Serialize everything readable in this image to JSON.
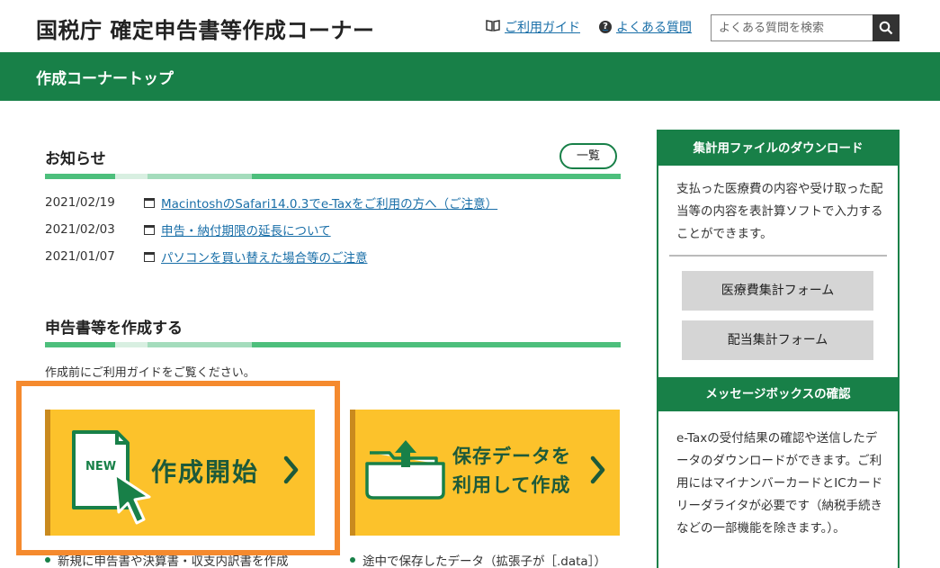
{
  "header": {
    "title": "国税庁 確定申告書等作成コーナー",
    "guide_label": "ご利用ガイド",
    "faq_label": "よくある質問",
    "search_placeholder": "よくある質問を検索"
  },
  "nav": {
    "label": "作成コーナートップ"
  },
  "news": {
    "title": "お知らせ",
    "list_button": "一覧",
    "items": [
      {
        "date": "2021/02/19",
        "text": "MacintoshのSafari14.0.3でe-Taxをご利用の方へ（ご注意）"
      },
      {
        "date": "2021/02/03",
        "text": "申告・納付期限の延長について"
      },
      {
        "date": "2021/01/07",
        "text": "パソコンを買い替えた場合等のご注意"
      }
    ]
  },
  "create": {
    "title": "申告書等を作成する",
    "note": "作成前にご利用ガイドをご覧ください。",
    "start_button": "作成開始",
    "new_badge": "NEW",
    "saved_button_line1": "保存データを",
    "saved_button_line2": "利用して作成",
    "bullet_start": "新規に申告書や決算書・収支内訳書を作成",
    "bullet_saved": "途中で保存したデータ（拡張子が［.data］）"
  },
  "sidebar": {
    "download_title": "集計用ファイルのダウンロード",
    "download_text": "支払った医療費の内容や受け取った配当等の内容を表計算ソフトで入力することができます。",
    "medical_button": "医療費集計フォーム",
    "dividend_button": "配当集計フォーム",
    "message_title": "メッセージボックスの確認",
    "message_text": "e-Taxの受付結果の確認や送信したデータのダウンロードができます。ご利用にはマイナンバーカードとICカードリーダライタが必要です（納税手続きなどの一部機能を除きます。）。"
  },
  "colors": {
    "brand_green": "#188048",
    "accent_yellow": "#fcc22b",
    "highlight_orange": "#f58a2e",
    "link_blue": "#1a6fa8"
  },
  "icons": {
    "guide": "book-icon",
    "faq": "question-circle-icon",
    "search": "search-icon",
    "news_item": "window-icon",
    "start": "new-document-cursor-icon",
    "saved": "folder-upload-icon",
    "arrow": "chevron-right-icon"
  }
}
